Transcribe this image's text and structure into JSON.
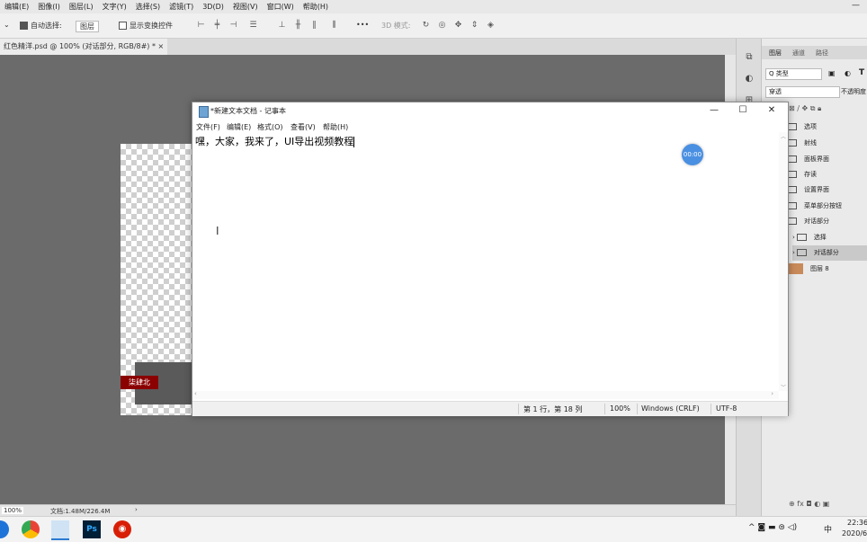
{
  "ps": {
    "menu": [
      "编辑(E)",
      "图像(I)",
      "图层(L)",
      "文字(Y)",
      "选择(S)",
      "滤镜(T)",
      "3D(D)",
      "视图(V)",
      "窗口(W)",
      "帮助(H)"
    ],
    "window_min": "—",
    "options": {
      "auto_select": "自动选择:",
      "auto_select_value": "图层",
      "show_transform": "显示变换控件",
      "mode_3d": "3D 模式:",
      "more": "•••"
    },
    "doc_tab": "红色精洋.psd @ 100% (对话部分, RGB/8#) * ×",
    "canvas_badge": "柒肆北",
    "status": {
      "zoom": "100%",
      "doc_size": "文档:1.48M/226.4M",
      "arrow": "›"
    }
  },
  "layers": {
    "tabs": [
      "图层",
      "通道",
      "路径"
    ],
    "filter": "Q 类型",
    "blend": "穿透",
    "opacity_label": "不透明度",
    "rows": [
      {
        "name": "选项",
        "type": "folder",
        "selected": false
      },
      {
        "name": "射线",
        "type": "folder",
        "selected": false
      },
      {
        "name": "面板界面",
        "type": "folder",
        "selected": false
      },
      {
        "name": "存读",
        "type": "folder",
        "selected": false
      },
      {
        "name": "设置界面",
        "type": "folder",
        "selected": false
      },
      {
        "name": "菜单部分按钮",
        "type": "folder",
        "selected": false
      },
      {
        "name": "对话部分",
        "type": "folder-open",
        "selected": false
      },
      {
        "name": "选择",
        "type": "folder",
        "selected": false
      },
      {
        "name": "对话部分",
        "type": "folder",
        "selected": true
      },
      {
        "name": "图层 8",
        "type": "image",
        "selected": false
      }
    ],
    "bottom_icons": "⊕  fx  ◘  ◐  ▣"
  },
  "notepad": {
    "title": "*新建文本文档 - 记事本",
    "menu": [
      "文件(F)",
      "编辑(E)",
      "格式(O)",
      "查看(V)",
      "帮助(H)"
    ],
    "content": "嘿，大家，我来了，UI导出视频教程",
    "status": {
      "position": "第 1 行，第 18 列",
      "zoom": "100%",
      "eol": "Windows (CRLF)",
      "encoding": "UTF-8"
    },
    "buttons": {
      "minimize": "—",
      "maximize": "☐",
      "close": "✕"
    }
  },
  "recorder_timer": "00:00",
  "taskbar": {
    "ime": "中",
    "time": "22:36",
    "date": "2020/6/",
    "tray_icons": "^  ◙  ▬  ⊜  ◁)"
  },
  "colors": {
    "canvas_badge": "#8b0000",
    "timer": "#4a90e2",
    "ps_bg": "#6b6b6b"
  }
}
